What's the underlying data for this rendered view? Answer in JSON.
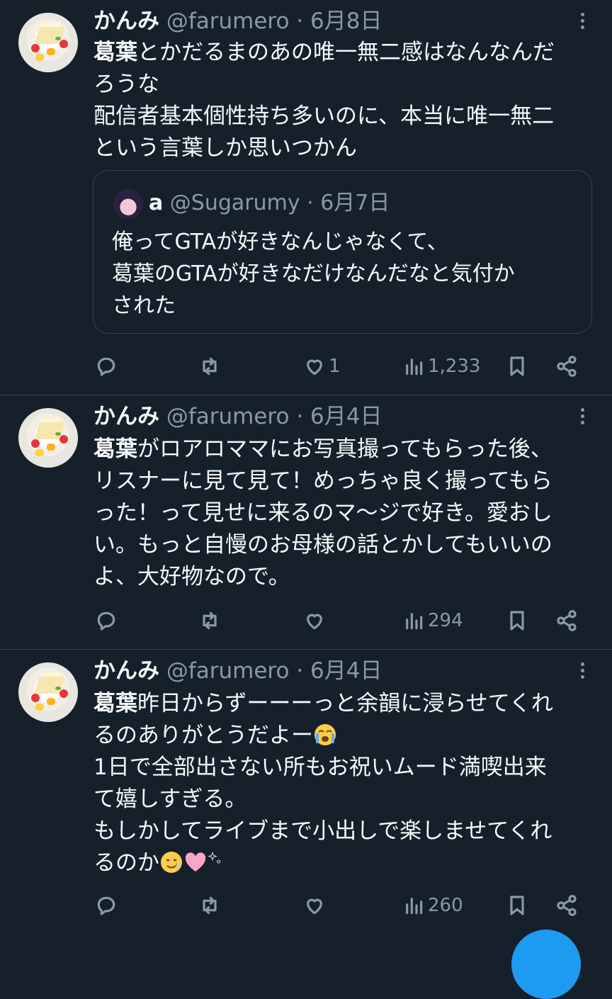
{
  "tweets": [
    {
      "name": "かんみ",
      "handle": "@farumero",
      "sep": " · ",
      "date": "6月8日",
      "bold_lead": "葛葉",
      "body": "とかだるまのあの唯一無二感はなんなんだ\nろうな\n配信者基本個性持ち多いのに、本当に唯一無二\nという言葉しか思いつかん",
      "quote": {
        "name": "a",
        "handle": "@Sugarumy",
        "sep": " · ",
        "date": "6月7日",
        "text": "俺ってGTAが好きなんじゃなくて、\n葛葉のGTAが好きなだけなんだなと気付か\nされた"
      },
      "likes": "1",
      "views": "1,233"
    },
    {
      "name": "かんみ",
      "handle": "@farumero",
      "sep": " · ",
      "date": "6月4日",
      "bold_lead": "葛葉",
      "body": "がロアロママにお写真撮ってもらった後、\nリスナーに見て見て！めっちゃ良く撮ってもら\nった！って見せに来るのマ〜ジで好き。愛おし\nい。もっと自慢のお母様の話とかしてもいいの\nよ、大好物なので。",
      "likes": "",
      "views": "294"
    },
    {
      "name": "かんみ",
      "handle": "@farumero",
      "sep": " · ",
      "date": "6月4日",
      "bold_lead": "葛葉",
      "body_a": "昨日からずーーーっと余韻に浸らせてくれ\nるのありがとうだよー",
      "body_b": "\n1日で全部出さない所もお祝いムード満喫出来\nて嬉しすぎる。\nもしかしてライブまで小出しで楽しませてくれ\nるのか",
      "emoji_names": [
        "loudly-crying-face",
        "smiling-face-with-tear",
        "pink-heart",
        "sparkles"
      ],
      "likes": "",
      "views": "260"
    }
  ],
  "colors": {
    "background": "#15202b",
    "text": "#f7f9f9",
    "secondary": "#8b98a5",
    "border": "#38444d",
    "accent": "#1d9bf0"
  },
  "icons": [
    "reply-icon",
    "retweet-icon",
    "like-icon",
    "views-icon",
    "bookmark-icon",
    "share-icon",
    "more-icon"
  ]
}
